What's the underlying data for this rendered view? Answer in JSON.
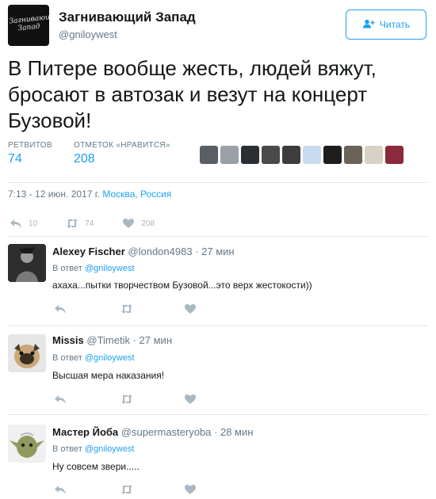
{
  "tweet": {
    "author_name": "Загнивающий Запад",
    "author_handle": "@gniloywest",
    "avatar_logo_text": "Загнивающий Запад",
    "follow_label": "Читать",
    "text": "В Питере вообще жесть, людей вяжут, бросают в автозак и везут на концерт Бузовой!",
    "retweets_label": "РЕТВИТОВ",
    "retweets_count": "74",
    "likes_label": "ОТМЕТОК «НРАВИТСЯ»",
    "likes_count": "208",
    "time": "7:13 - 12 июн. 2017 г.",
    "location": "Москва, Россия",
    "reply_count": "10",
    "retweet_count_action": "74",
    "like_count_action": "208"
  },
  "likers": [
    {
      "icon": "liker-avatar-1",
      "color": "#5a5f66"
    },
    {
      "icon": "liker-avatar-2",
      "color": "#9aa0a6"
    },
    {
      "icon": "liker-avatar-3",
      "color": "#2b2f33"
    },
    {
      "icon": "liker-avatar-4",
      "color": "#4a4a4a"
    },
    {
      "icon": "liker-avatar-5",
      "color": "#3d3d3d"
    },
    {
      "icon": "liker-avatar-6",
      "color": "#c9dbee"
    },
    {
      "icon": "liker-avatar-7",
      "color": "#1e1e1e"
    },
    {
      "icon": "liker-avatar-8",
      "color": "#6b6258"
    },
    {
      "icon": "liker-avatar-9",
      "color": "#d8d2c4"
    },
    {
      "icon": "liker-avatar-10",
      "color": "#8a2a3a"
    }
  ],
  "replies": [
    {
      "name": "Alexey Fischer",
      "handle": "@london4983",
      "time": "· 27 мин",
      "reply_prefix": "В ответ",
      "reply_to": "@gniloywest",
      "text": "ахаха...пытки творчеством Бузовой...это верх жестокости))"
    },
    {
      "name": "Missis",
      "handle": "@Timetik",
      "time": "· 27 мин",
      "reply_prefix": "В ответ",
      "reply_to": "@gniloywest",
      "text": "Высшая мера наказания!"
    },
    {
      "name": "Мастер Йоба",
      "handle": "@supermasteryoba",
      "time": "· 28 мин",
      "reply_prefix": "В ответ",
      "reply_to": "@gniloywest",
      "text": "Ну совсем звери....."
    }
  ],
  "colors": {
    "accent": "#1da1f2",
    "muted": "#657786",
    "icon_gray": "#aab8c2",
    "divider": "#e1e8ed"
  }
}
